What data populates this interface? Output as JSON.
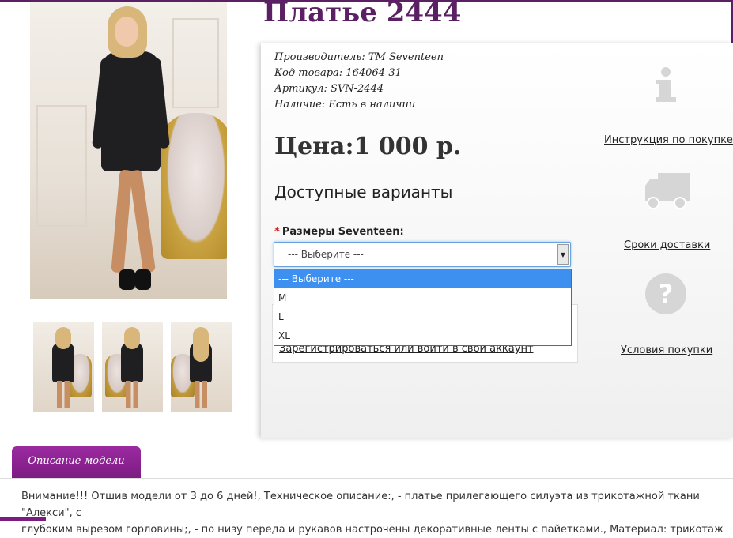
{
  "product": {
    "title": "Платье 2444",
    "manufacturer": "Производитель: ТМ Seventeen",
    "code": "Код товара: 164064-31",
    "sku": "Артикул: SVN-2444",
    "availability": "Наличие: Есть в наличии",
    "price": "Цена:1 000 р."
  },
  "options": {
    "heading": "Доступные варианты",
    "required_mark": "*",
    "size_label": "Размеры Seventeen:",
    "selected": "--- Выберите ---",
    "items": [
      "--- Выберите ---",
      "M",
      "L",
      "XL"
    ]
  },
  "login_text": "Зарегистрироваться или войти в свой аккаунт",
  "side_links": {
    "instruction": "Инструкция по покупке",
    "delivery": "Сроки доставки",
    "terms": "Условия покупки"
  },
  "description": {
    "tab_label": "Описание модели",
    "line1": "Внимание!!! Отшив модели от 3 до 6 дней!, Техническое описание:, - платье прилегающего силуэта из трикотажной ткани \"Алекси\", с",
    "line2": "глубоким вырезом горловины;, - по низу переда и рукавов настрочены декоративные ленты с пайетками., Материал: трикотаж"
  },
  "colors": {
    "brand": "#5b1f63",
    "tab": "#8a2291",
    "select_highlight": "#3d8ff0"
  },
  "icons": [
    "info-icon",
    "delivery-truck-icon",
    "question-icon",
    "dropdown-arrow-icon"
  ]
}
